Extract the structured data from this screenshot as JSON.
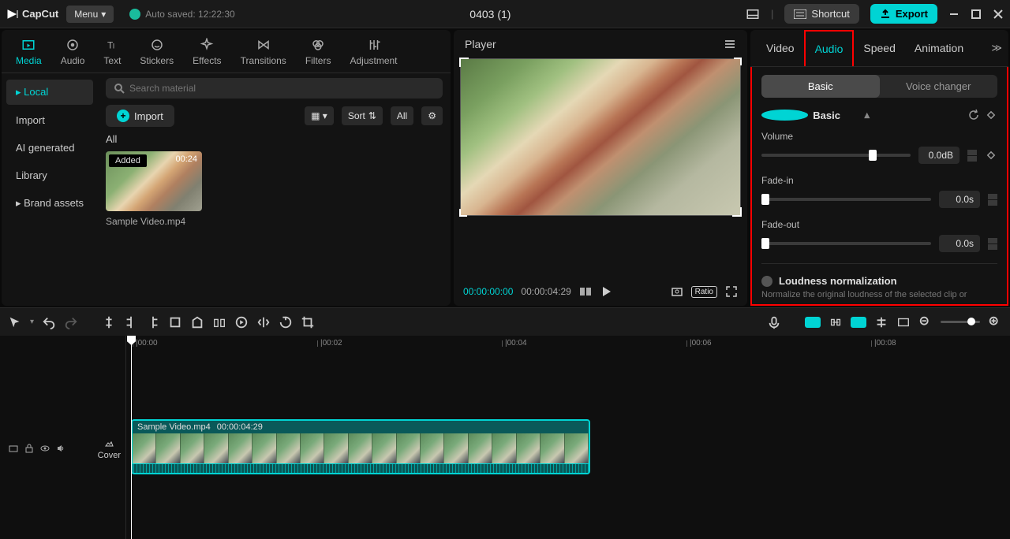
{
  "app": {
    "name": "CapCut",
    "menu": "Menu",
    "autoSaved": "Auto saved: 12:22:30",
    "projectTitle": "0403 (1)",
    "shortcut": "Shortcut",
    "export": "Export"
  },
  "topTabs": {
    "media": "Media",
    "audio": "Audio",
    "text": "Text",
    "stickers": "Stickers",
    "effects": "Effects",
    "transitions": "Transitions",
    "filters": "Filters",
    "adjustment": "Adjustment"
  },
  "sidebar": {
    "local": "Local",
    "import": "Import",
    "aiGenerated": "AI generated",
    "library": "Library",
    "brandAssets": "Brand assets"
  },
  "media": {
    "searchPlaceholder": "Search material",
    "import": "Import",
    "sort": "Sort",
    "all": "All",
    "allLabel": "All",
    "thumbBadge": "Added",
    "thumbTime": "00:24",
    "thumbName": "Sample Video.mp4"
  },
  "player": {
    "title": "Player",
    "tc1": "00:00:00:00",
    "tc2": "00:00:04:29",
    "ratio": "Ratio"
  },
  "inspector": {
    "tabs": {
      "video": "Video",
      "audio": "Audio",
      "speed": "Speed",
      "animation": "Animation"
    },
    "subtabs": {
      "basic": "Basic",
      "voiceChanger": "Voice changer"
    },
    "basicLabel": "Basic",
    "volume": {
      "label": "Volume",
      "value": "0.0dB"
    },
    "fadeIn": {
      "label": "Fade-in",
      "value": "0.0s"
    },
    "fadeOut": {
      "label": "Fade-out",
      "value": "0.0s"
    },
    "loudness": {
      "label": "Loudness normalization",
      "desc": "Normalize the original loudness of the selected clip or"
    }
  },
  "timeline": {
    "ticks": [
      "|00:00",
      "|00:02",
      "|00:04",
      "|00:06",
      "|00:08"
    ],
    "clipName": "Sample Video.mp4",
    "clipDur": "00:00:04:29",
    "cover": "Cover"
  }
}
